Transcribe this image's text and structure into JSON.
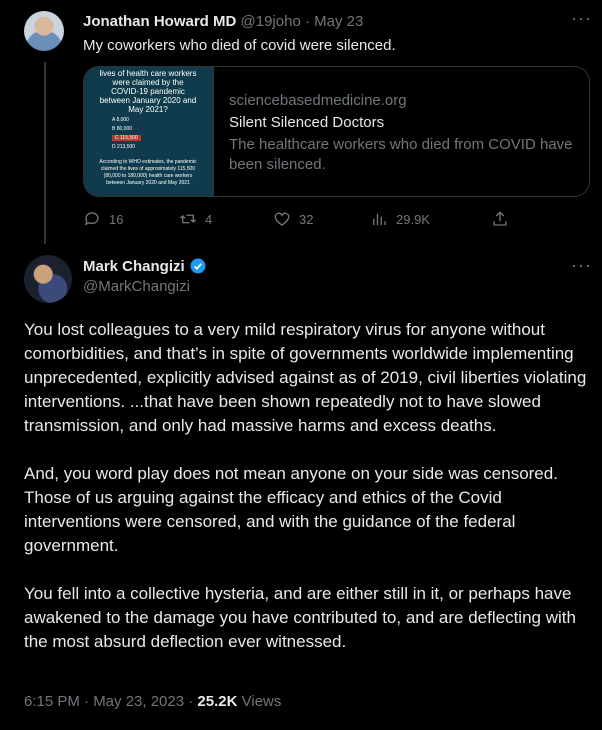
{
  "tweet1": {
    "name": "Jonathan Howard MD",
    "handle": "@19joho",
    "date": "· May 23",
    "text": "My coworkers who died of covid were silenced.",
    "card": {
      "image_caption": "lives of health care workers were claimed by the COVID-19 pandemic between January 2020 and May 2021?",
      "image_options": [
        "A  8,000",
        "B  80,000",
        "C  115,500",
        "D  213,500"
      ],
      "image_note": "According to WHO estimates, the pandemic claimed the lives of approximately 115,500 (80,000 to 180,000) health care workers between January 2020 and May 2021",
      "domain": "sciencebasedmedicine.org",
      "title": "Silent Silenced Doctors",
      "description": "The healthcare workers who died from COVID have been silenced."
    },
    "stats": {
      "replies": "16",
      "retweets": "4",
      "likes": "32",
      "views": "29.9K"
    }
  },
  "tweet2": {
    "name": "Mark Changizi",
    "handle": "@MarkChangizi",
    "paragraphs": [
      "You lost colleagues to a very mild respiratory virus for anyone without comorbidities, and that’s in spite of governments worldwide implementing unprecedented, explicitly advised against as of 2019, civil liberties violating interventions. ...that have been shown repeatedly not to have slowed transmission, and only had massive harms and excess deaths.",
      "And, you word play does not mean anyone on your side was censored. Those of us arguing against the efficacy and ethics of the Covid interventions were censored, and with the guidance of the federal government.",
      "You fell into a collective hysteria, and are either still in it, or perhaps have awakened to the damage you have contributed to, and are deflecting with the most absurd deflection ever witnessed."
    ],
    "timestamp": "6:15 PM · May 23, 2023 ·",
    "views_count": "25.2K",
    "views_label": "Views"
  },
  "colors": {
    "background": "#000000",
    "text": "#e7e9ea",
    "muted": "#71767b",
    "verified": "#1d9bf0"
  },
  "more_glyph": "···"
}
